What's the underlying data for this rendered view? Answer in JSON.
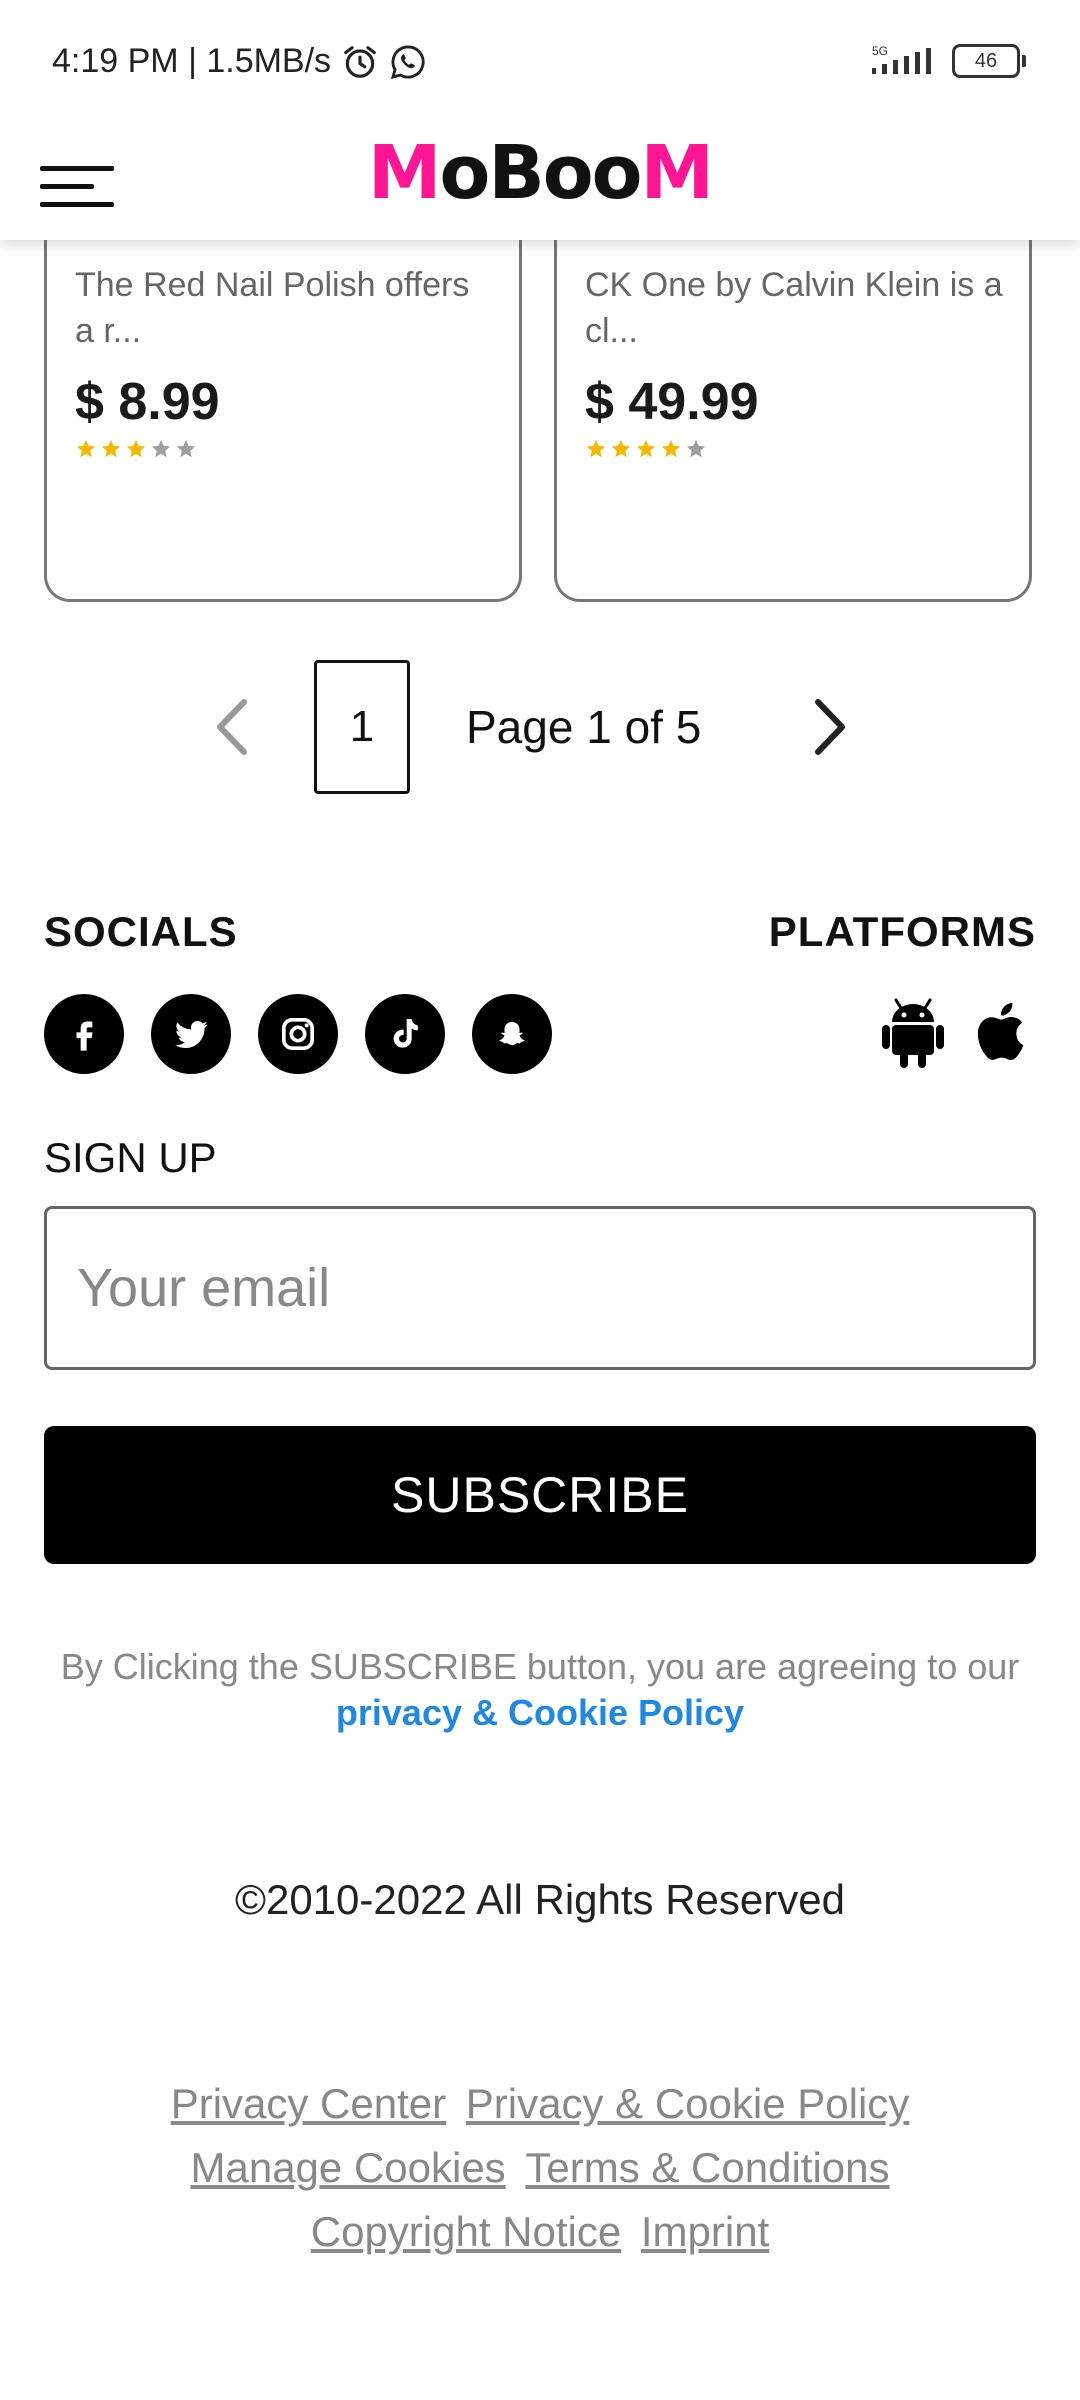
{
  "status_bar": {
    "time_speed": "4:19 PM | 1.5MB/s",
    "network": "5G",
    "battery": "46"
  },
  "header": {
    "logo_parts": [
      "M",
      "oBoo",
      "M"
    ],
    "brand_color": "#ff1493"
  },
  "products": [
    {
      "desc": "The Red Nail Polish offers a r...",
      "price": "$ 8.99",
      "rating": 3
    },
    {
      "desc": "CK One by Calvin Klein is a cl...",
      "price": "$ 49.99",
      "rating": 4
    }
  ],
  "pagination": {
    "current": "1",
    "label": "Page 1 of 5"
  },
  "socials": {
    "title": "SOCIALS",
    "icons": [
      "facebook-icon",
      "twitter-icon",
      "instagram-icon",
      "tiktok-icon",
      "snapchat-icon"
    ]
  },
  "platforms": {
    "title": "PLATFORMS",
    "icons": [
      "android-icon",
      "apple-icon"
    ]
  },
  "signup": {
    "label": "SIGN UP",
    "placeholder": "Your email",
    "button": "SUBSCRIBE",
    "consent_text": "By Clicking the SUBSCRIBE button, you are agreeing to our",
    "consent_link": "privacy & Cookie Policy",
    "link_color": "#1e88e5"
  },
  "footer": {
    "copyright": "©2010-2022 All Rights Reserved",
    "links": [
      [
        "Privacy Center",
        "Privacy & Cookie Policy"
      ],
      [
        "Manage Cookies",
        "Terms & Conditions"
      ],
      [
        "Copyright Notice",
        "Imprint"
      ]
    ]
  }
}
